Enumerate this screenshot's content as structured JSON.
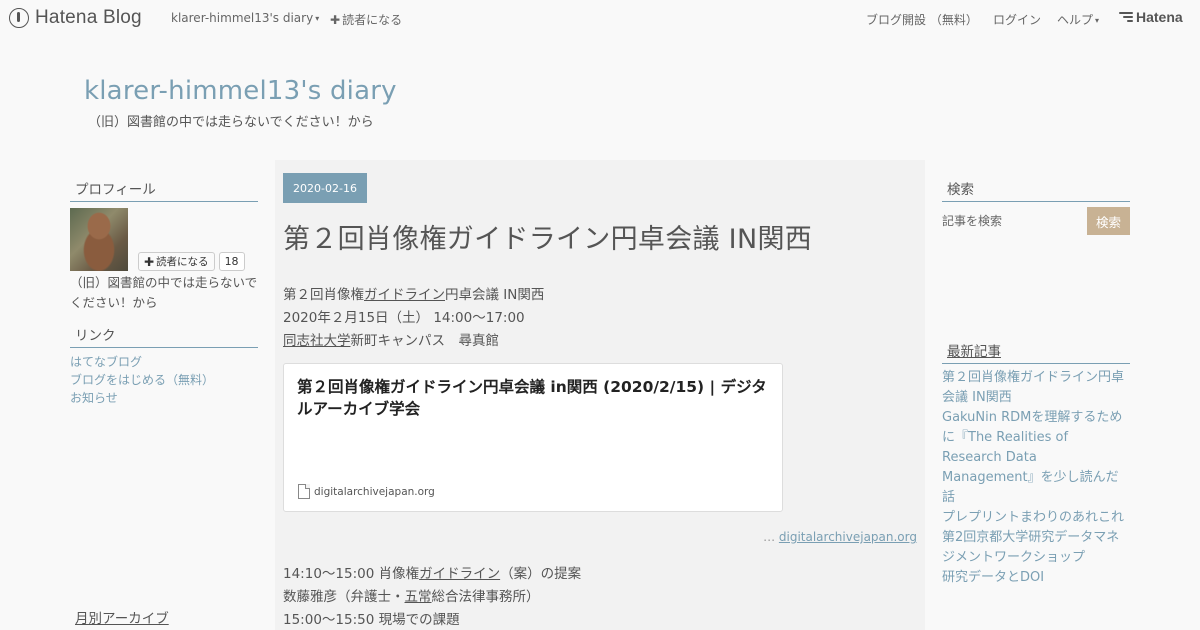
{
  "global_header": {
    "logo_text": "Hatena Blog",
    "diary_menu": "klarer-himmel13's diary",
    "subscribe": "読者になる",
    "open_blog": "ブログ開設 （無料）",
    "login": "ログイン",
    "help": "ヘルプ",
    "hatena_logo": "Hatena"
  },
  "blog": {
    "title": "klarer-himmel13's diary",
    "description": "（旧）図書館の中では走らないでください！から"
  },
  "sidebar_left": {
    "profile_title": "プロフィール",
    "subscribe_button": "読者になる",
    "reader_count": "18",
    "profile_description": "（旧）図書館の中では走らないでください！から",
    "links_title": "リンク",
    "links": [
      "はてなブログ",
      "ブログをはじめる（無料）",
      "お知らせ"
    ],
    "archive_title": "月別アーカイブ"
  },
  "entry": {
    "date": "2020-02-16",
    "title": "第２回肖像権ガイドライン円卓会議 IN関西",
    "line1_pre": "第２回肖像権",
    "line1_kw": "ガイドライン",
    "line1_post": "円卓会議 IN関西",
    "line2": "2020年２月15日（土） 14:00～17:00",
    "line3_kw": "同志社大学",
    "line3_post": "新町キャンパス　尋真館",
    "embed": {
      "title": "第２回肖像権ガイドライン円卓会議 in関西 (2020/2/15) | デジタルアーカイブ学会",
      "domain": "digitalarchivejapan.org"
    },
    "cite_prefix": "…",
    "cite_link": "digitalarchivejapan.org",
    "p1_pre": "14:10～15:00 肖像権",
    "p1_kw": "ガイドライン",
    "p1_post": "（案）の提案",
    "p2_pre": "数藤雅彦（弁護士・",
    "p2_kw": "五常",
    "p2_post": "総合法律事務所）",
    "p3": "15:00～15:50 現場での課題"
  },
  "sidebar_right": {
    "search_title": "検索",
    "search_placeholder": "記事を検索",
    "search_button": "検索",
    "recent_title": "最新記事",
    "recent_posts": [
      "第２回肖像権ガイドライン円卓会議 IN関西",
      "GakuNin RDMを理解するために『The Realities of Research Data Management』を少し読んだ話",
      "プレプリントまわりのあれこれ",
      "第2回京都大学研究データマネジメントワークショップ",
      "研究データとDOI"
    ]
  },
  "colors": {
    "accent": "#7a9fb3",
    "search_button": "#c8b294",
    "background": "#f9f9f9",
    "main_background": "#f2f2f2"
  }
}
